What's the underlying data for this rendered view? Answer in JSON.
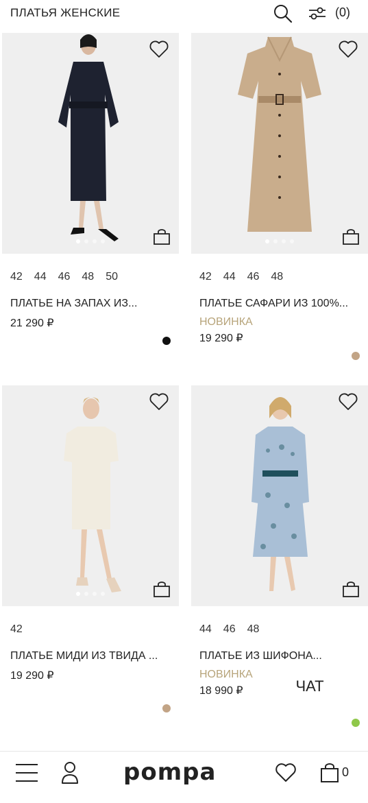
{
  "header": {
    "title": "ПЛАТЬЯ ЖЕНСКИЕ",
    "filter_count": "(0)"
  },
  "products": [
    {
      "sizes": [
        "42",
        "44",
        "46",
        "48",
        "50"
      ],
      "name": "ПЛАТЬЕ НА ЗАПАХ ИЗ...",
      "badge": "",
      "price": "21 290 ₽",
      "color": "#111111"
    },
    {
      "sizes": [
        "42",
        "44",
        "46",
        "48"
      ],
      "name": "ПЛАТЬЕ САФАРИ ИЗ 100%...",
      "badge": "НОВИНКА",
      "price": "19 290 ₽",
      "color": "#c2a486"
    },
    {
      "sizes": [
        "42"
      ],
      "name": "ПЛАТЬЕ МИДИ ИЗ ТВИДА ...",
      "badge": "",
      "price": "19 290 ₽",
      "color": "#c2a486"
    },
    {
      "sizes": [
        "44",
        "46",
        "48"
      ],
      "name": "ПЛАТЬЕ ИЗ ШИФОНА...",
      "badge": "НОВИНКА",
      "price": "18 990 ₽",
      "color": "#8fc84a"
    }
  ],
  "chat_label": "ЧАТ",
  "bottom_nav": {
    "logo": "pompa",
    "cart_count": "0"
  },
  "icons": [
    "search-icon",
    "filter-icon",
    "heart-icon",
    "bag-icon",
    "menu-icon",
    "user-icon",
    "cart-icon"
  ]
}
